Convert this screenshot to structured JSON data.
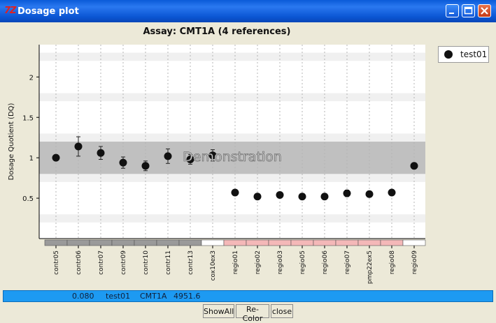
{
  "window": {
    "title": "Dosage plot",
    "app_icon": "7Z"
  },
  "chart_data": {
    "type": "scatter",
    "title": "Assay: CMT1A (4 references)",
    "ylabel": "Dosage Quotient (DQ)",
    "xlabel": "",
    "ylim": [
      0.0,
      2.4
    ],
    "yticks": [
      0.5,
      1,
      1.5,
      2
    ],
    "ytick_labels": [
      "0.5",
      "1",
      "1.5",
      "2"
    ],
    "categories": [
      "contr05",
      "contr06",
      "contr07",
      "contr09",
      "contr10",
      "contr11",
      "contr13",
      "cox10ex3",
      "regio01",
      "regio02",
      "regio03",
      "regio05",
      "regio06",
      "regio07",
      "pmp22ex5",
      "regio08",
      "regio09"
    ],
    "category_groups": [
      "control",
      "control",
      "control",
      "control",
      "control",
      "control",
      "control",
      "other",
      "region",
      "region",
      "region",
      "region",
      "region",
      "region",
      "region",
      "region",
      "other"
    ],
    "series": [
      {
        "name": "test01",
        "values": [
          1.0,
          1.14,
          1.06,
          0.94,
          0.9,
          1.02,
          0.98,
          1.03,
          0.57,
          0.52,
          0.54,
          0.52,
          0.52,
          0.56,
          0.55,
          0.57,
          0.9
        ],
        "error": [
          0.03,
          0.12,
          0.08,
          0.07,
          0.06,
          0.09,
          0.06,
          0.07,
          0.03,
          0.02,
          0.02,
          0.02,
          0.02,
          0.04,
          0.02,
          0.02,
          0.03
        ]
      }
    ],
    "normal_band": [
      0.8,
      1.2
    ],
    "background_bands": [
      [
        0.2,
        0.3
      ],
      [
        1.7,
        1.8
      ],
      [
        2.2,
        2.3
      ],
      [
        0.7,
        0.8
      ],
      [
        1.2,
        1.3
      ]
    ],
    "watermark": "Demonstration",
    "grid": true,
    "legend_position": "right"
  },
  "colors": {
    "control_bar": "#9a9a9a",
    "region_bar": "#f4b8b8",
    "other_bar": "#ffffff",
    "normal_band": "#c0c0c0",
    "alt_band": "#f0f0f0",
    "status_bar": "#1d9af2"
  },
  "status": {
    "value": "0.080",
    "sample": "test01",
    "assay": "CMT1A",
    "extra": "4951.6"
  },
  "buttons": {
    "show_all": "ShowAll",
    "recolor": "Re-Color",
    "close": "close"
  }
}
